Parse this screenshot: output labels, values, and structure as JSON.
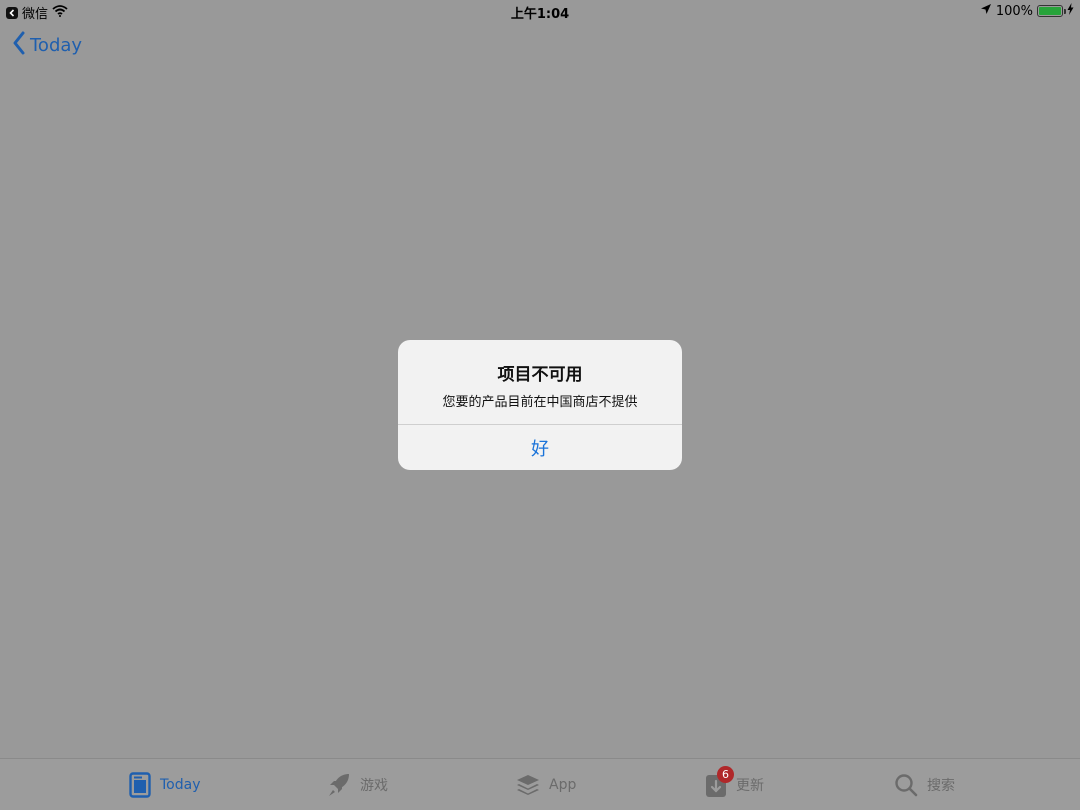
{
  "status_bar": {
    "back_app": "微信",
    "time": "上午1:04",
    "battery": "100%",
    "battery_level": 1.0
  },
  "nav": {
    "back_label": "Today"
  },
  "alert": {
    "title": "项目不可用",
    "message": "您要的产品目前在中国商店不提供",
    "ok_label": "好"
  },
  "tabs": [
    {
      "label": "Today",
      "icon": "today-icon",
      "active": true
    },
    {
      "label": "游戏",
      "icon": "rocket-icon"
    },
    {
      "label": "App",
      "icon": "layers-icon"
    },
    {
      "label": "更新",
      "icon": "download-icon",
      "badge": "6"
    },
    {
      "label": "搜索",
      "icon": "search-icon"
    }
  ],
  "colors": {
    "accent": "#1f5fae",
    "alert_button": "#1a73d9",
    "badge": "#b0282a",
    "battery": "#27a33a"
  }
}
